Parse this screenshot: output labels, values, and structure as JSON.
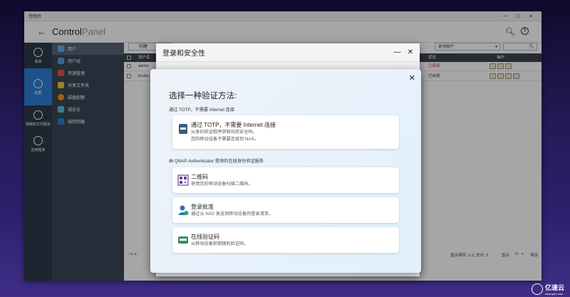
{
  "window": {
    "title": "控制台",
    "app_name_a": "Control",
    "app_name_b": "Panel"
  },
  "leftnav": [
    {
      "label": "系统"
    },
    {
      "label": "权限"
    },
    {
      "label": "网络和文件服务"
    },
    {
      "label": "应用程序"
    }
  ],
  "subnav": [
    "用户",
    "用户组",
    "资源管理",
    "共享文件夹",
    "磁盘配额",
    "域安全",
    "域控制器"
  ],
  "toolbar": {
    "create_label": "创建",
    "user_scope": "本地用户"
  },
  "grid": {
    "col_user": "用户名",
    "col_status": "状态",
    "col_actions": "操作",
    "rows": [
      {
        "name": "admin",
        "status": "已禁用"
      },
      {
        "name": "knube",
        "status": "已启用"
      }
    ]
  },
  "footer": {
    "display_items": "显示项目: 1-2, 总计: 2",
    "display_label": "显示",
    "per_page": "10",
    "items_label": "项目"
  },
  "back_dialog": {
    "title": "登录和安全性"
  },
  "dialog": {
    "title": "选择一种验证方法:",
    "section1": "通过 TOTP，不需要 Internet 连接",
    "section2": "由 QNAP Authenticator 提供的在线身份验证服务",
    "options": [
      {
        "title": "通过 TOTP，不需要 Internet 连接",
        "desc1": "从身份验证程序获取动态安全码。",
        "desc2": "您的移动设备不需要连接到 NAS。"
      },
      {
        "title": "二维码",
        "desc1": "使用您的移动设备扫描二维码。"
      },
      {
        "title": "登录批准",
        "desc1": "通过从 NAS 发送到移动设备的登录请求。"
      },
      {
        "title": "在线验证码",
        "desc1": "从移动设备获取随机验证码。"
      }
    ]
  },
  "watermark": {
    "text": "亿速云",
    "sub": "www.yisu.com"
  }
}
